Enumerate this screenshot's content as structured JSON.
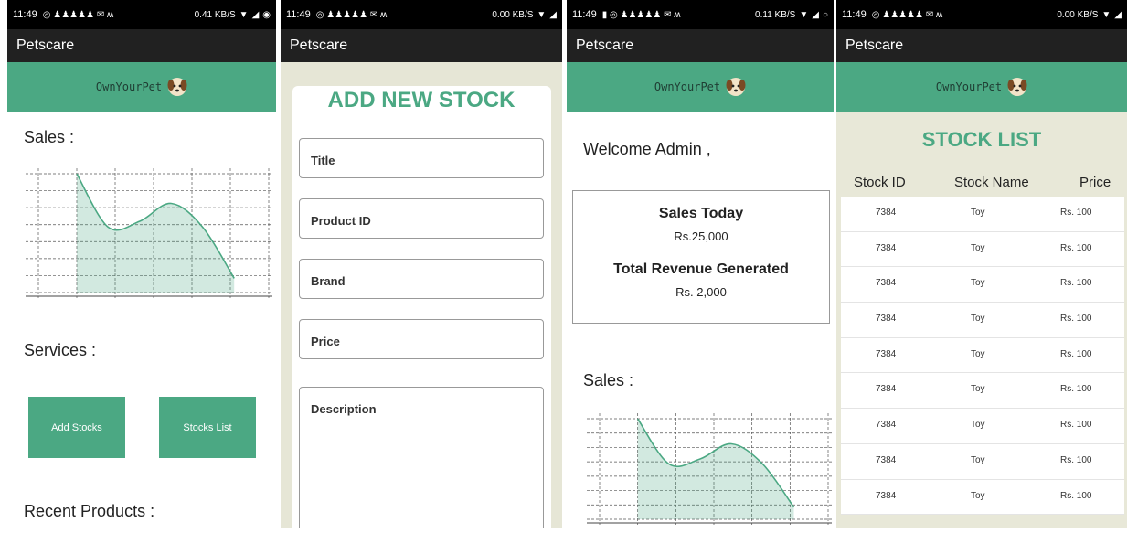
{
  "status": {
    "p1": {
      "time": "11:49",
      "speed": "0.41 KB/S"
    },
    "p2": {
      "time": "11:49",
      "speed": "0.00 KB/S"
    },
    "p3": {
      "time": "11:49",
      "speed": "0.11 KB/S"
    },
    "p4": {
      "time": "11:49",
      "speed": "0.00 KB/S"
    }
  },
  "app_title": "Petscare",
  "brand": "OwnYourPet",
  "home": {
    "sales_label": "Sales :",
    "services_label": "Services :",
    "add_stocks_button": "Add Stocks",
    "stocks_list_button": "Stocks List",
    "recent_products_label": "Recent Products :"
  },
  "add_stock": {
    "title": "ADD NEW STOCK",
    "fields": {
      "title": "Title",
      "product_id": "Product ID",
      "brand": "Brand",
      "price": "Price",
      "description": "Description"
    }
  },
  "dashboard": {
    "welcome": "Welcome Admin ,",
    "sales_today_label": "Sales Today",
    "sales_today_value": "Rs.25,000",
    "revenue_label": "Total Revenue Generated",
    "revenue_value": "Rs. 2,000",
    "sales_label": "Sales :"
  },
  "stock_list": {
    "title": "STOCK LIST",
    "columns": [
      "Stock ID",
      "Stock Name",
      "Price"
    ],
    "rows": [
      [
        "7384",
        "Toy",
        "Rs. 100"
      ],
      [
        "7384",
        "Toy",
        "Rs. 100"
      ],
      [
        "7384",
        "Toy",
        "Rs. 100"
      ],
      [
        "7384",
        "Toy",
        "Rs. 100"
      ],
      [
        "7384",
        "Toy",
        "Rs. 100"
      ],
      [
        "7384",
        "Toy",
        "Rs. 100"
      ],
      [
        "7384",
        "Toy",
        "Rs. 100"
      ],
      [
        "7384",
        "Toy",
        "Rs. 100"
      ],
      [
        "7384",
        "Toy",
        "Rs. 100"
      ]
    ]
  },
  "colors": {
    "accent": "#4ba883",
    "appbar": "#212121",
    "card_bg": "#e6e6d6"
  },
  "chart_data": {
    "type": "area",
    "title": "",
    "xlabel": "",
    "ylabel": "",
    "curve": "smooth",
    "shape": [
      1.0,
      0.55,
      0.6,
      0.75,
      0.55,
      0.12
    ],
    "grid": true
  }
}
